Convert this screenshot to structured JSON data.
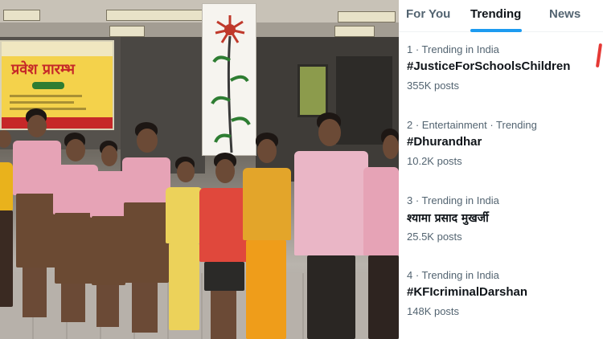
{
  "photo": {
    "poster_title": "प्रवेश प्रारम्भ"
  },
  "tabs": [
    {
      "label": "For You",
      "active": false
    },
    {
      "label": "Trending",
      "active": true
    },
    {
      "label": "News",
      "active": false
    }
  ],
  "trends": [
    {
      "meta": "1 · Trending in India",
      "name": "#JusticeForSchoolsChildren",
      "posts": "355K posts"
    },
    {
      "meta": "2 · Entertainment · Trending",
      "name": "#Dhurandhar",
      "posts": "10.2K posts"
    },
    {
      "meta": "3 · Trending in India",
      "name": "श्यामा प्रसाद मुखर्जी",
      "posts": "25.5K posts"
    },
    {
      "meta": "4 · Trending in India",
      "name": "#KFIcriminalDarshan",
      "posts": "148K posts"
    }
  ],
  "colors": {
    "accent": "#1d9bf0",
    "text_primary": "#0f1419",
    "text_secondary": "#536471",
    "annotation": "#e53935"
  }
}
